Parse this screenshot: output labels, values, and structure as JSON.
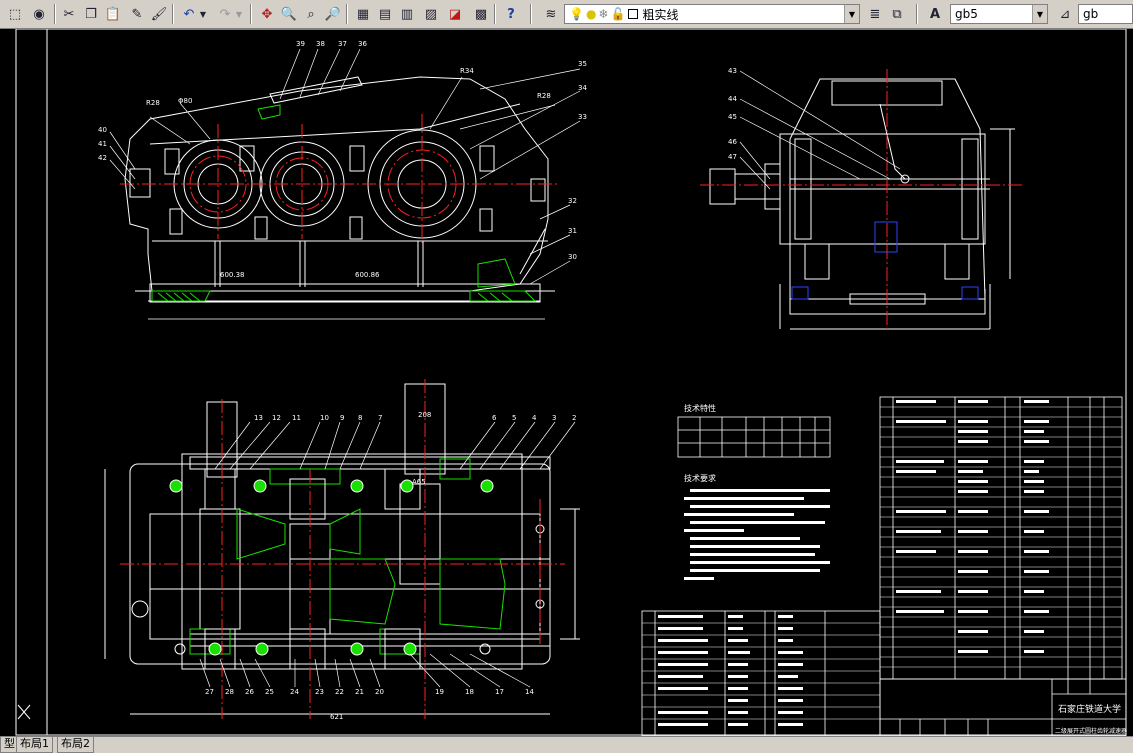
{
  "toolbar": {
    "layer_name": "粗实线",
    "text_style": "gb5",
    "dim_style": "gb"
  },
  "drawing": {
    "school_name": "石家庄铁道大学",
    "drawing_name": "二级展开式圆柱齿轮减速器",
    "tech_chars_title": "技术特性",
    "tech_req_title": "技术要求",
    "dim_overall_length": "621",
    "dim_center_a": "A65",
    "dim_top_width": "208"
  },
  "tabs": [
    {
      "label": "型"
    },
    {
      "label": "布局1"
    },
    {
      "label": "布局2"
    }
  ]
}
